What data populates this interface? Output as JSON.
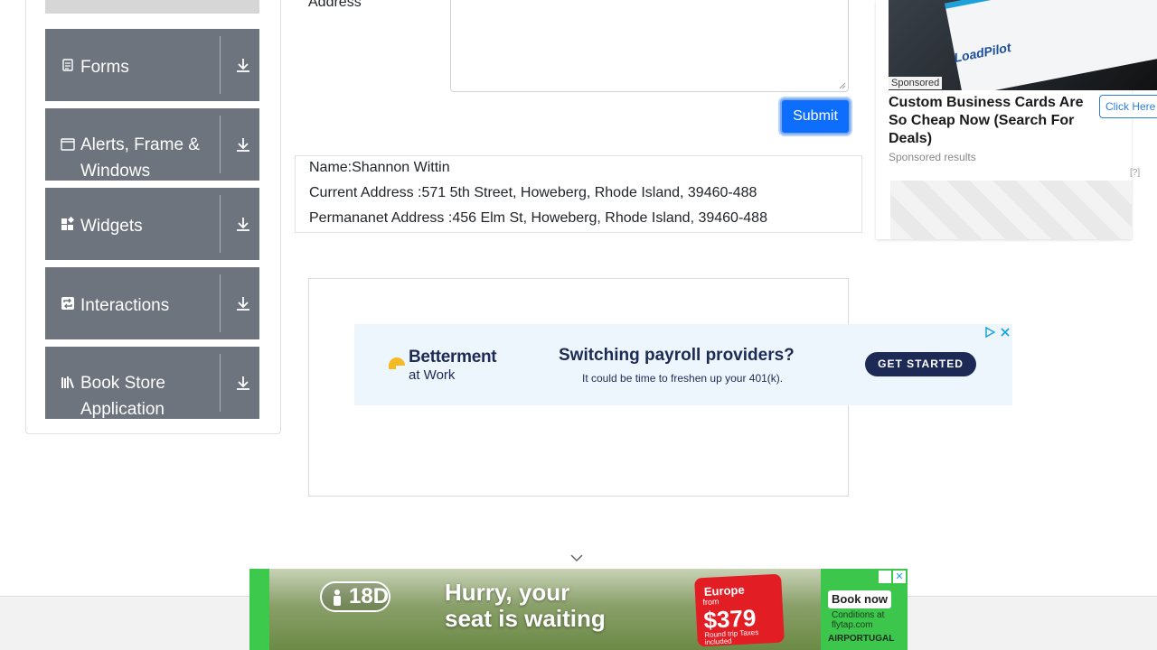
{
  "sidebar": {
    "groups": [
      {
        "label": "Forms",
        "icon": "form-icon"
      },
      {
        "label": "Alerts, Frame & Windows",
        "icon": "window-icon"
      },
      {
        "label": "Widgets",
        "icon": "widgets-icon"
      },
      {
        "label": "Interactions",
        "icon": "interactions-icon"
      },
      {
        "label": "Book Store Application",
        "icon": "books-icon"
      }
    ]
  },
  "form": {
    "permanent_address_label": "Address",
    "submit_label": "Submit"
  },
  "output": {
    "name": "Name:Shannon Wittin",
    "current_address": "Current Address :571 5th Street, Howeberg, Rhode Island, 39460-488",
    "permanent_address": "Permananet Address :456 Elm St, Howeberg, Rhode Island, 39460-488"
  },
  "sponsored_ad": {
    "tag": "Sponsored",
    "title": "Custom Business Cards Are So Cheap Now (Search For Deals)",
    "cta": "Click Here",
    "results": "Sponsored results",
    "help": "[?]",
    "card_brand": "LoadPilot"
  },
  "betterment_ad": {
    "brand": "Betterment",
    "brand_sub": "at Work",
    "headline": "Switching payroll providers?",
    "text": "It could be time to freshen up your 401(k).",
    "cta": "GET STARTED"
  },
  "bottom_ad": {
    "age": "18D",
    "headline_1": "Hurry, your",
    "headline_2": "seat is waiting",
    "price_dest": "Europe",
    "price_from": "from",
    "price": "$379",
    "price_note": "Round trip Taxes included",
    "cta": "Book now",
    "conditions": "Conditions at flytap.com",
    "brand": "AIRPORTUGAL"
  },
  "colors": {
    "sidebar_group_bg": "#6d747d",
    "submit_bg": "#0d6efd",
    "betterment_navy": "#1d2a55"
  }
}
